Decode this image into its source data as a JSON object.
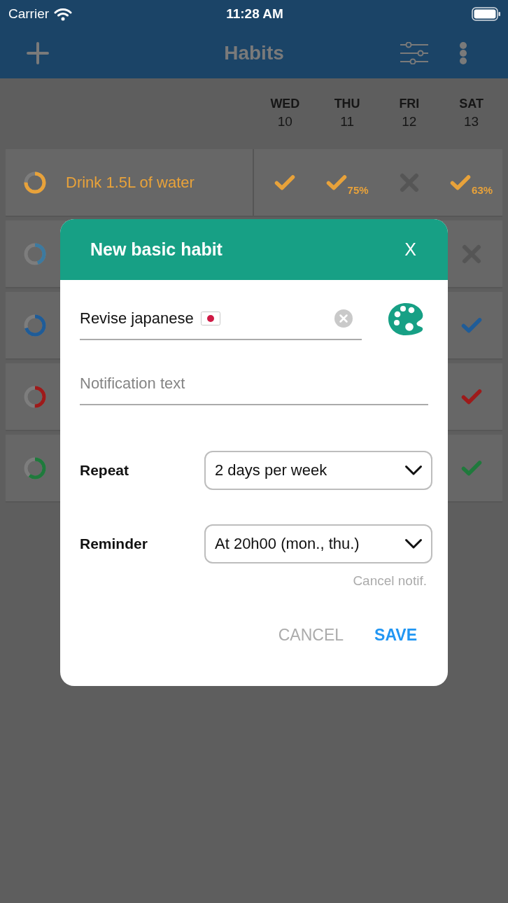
{
  "status_bar": {
    "carrier": "Carrier",
    "time": "11:28 AM"
  },
  "nav_bar": {
    "title": "Habits"
  },
  "days": [
    {
      "weekday": "WED",
      "date": "10"
    },
    {
      "weekday": "THU",
      "date": "11"
    },
    {
      "weekday": "FRI",
      "date": "12"
    },
    {
      "weekday": "SAT",
      "date": "13"
    }
  ],
  "habits": [
    {
      "name": "Drink 1.5L of water",
      "color": "#e8a23a",
      "level": 0.75,
      "days": [
        {
          "kind": "check"
        },
        {
          "kind": "check",
          "percent": "75%"
        },
        {
          "kind": "cross"
        },
        {
          "kind": "check",
          "percent": "63%"
        }
      ]
    },
    {
      "color": "#3c7aa0",
      "level": 0.45,
      "days": [
        {
          "kind": "cross"
        }
      ]
    },
    {
      "color": "#1f5c98",
      "level": 0.7,
      "days": [
        {
          "kind": "check"
        }
      ]
    },
    {
      "color": "#9e1a1a",
      "level": 0.5,
      "days": [
        {
          "kind": "check"
        }
      ]
    },
    {
      "color": "#1f7a3c",
      "level": 0.6,
      "days": [
        {
          "kind": "check"
        }
      ]
    }
  ],
  "dialog": {
    "title": "New basic habit",
    "close": "X",
    "name_field": {
      "value": "Revise japanese"
    },
    "notification_field": {
      "placeholder": "Notification text"
    },
    "selects": [
      {
        "kind": "repeat",
        "label": "Repeat",
        "value": "2 days per week"
      },
      {
        "kind": "reminder",
        "label": "Reminder",
        "value": "At 20h00 (mon., thu.)"
      }
    ],
    "cancel_notification": "Cancel notif.",
    "buttons": [
      {
        "kind": "secondary",
        "label": "CANCEL"
      },
      {
        "kind": "primary",
        "label": "SAVE"
      }
    ]
  }
}
